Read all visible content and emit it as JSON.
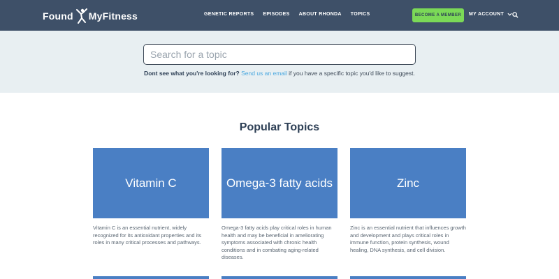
{
  "brand": {
    "name_left": "Found",
    "name_right": "MyFitness"
  },
  "nav": {
    "links": [
      "GENETIC REPORTS",
      "EPISODES",
      "ABOUT RHONDA",
      "TOPICS"
    ],
    "member_button": "BECOME A MEMBER",
    "account_label": "MY ACCOUNT"
  },
  "search": {
    "placeholder": "Search for a topic",
    "hint_strong": "Dont see what you're looking for?",
    "hint_link": "Send us an email",
    "hint_rest": "if you have a specific topic you'd like to suggest."
  },
  "popular": {
    "title": "Popular Topics",
    "cards": [
      {
        "title": "Vitamin C",
        "description": "Vitamin C is an essential nutrient, widely recognized for its antioxidant properties and its roles in many critical processes and pathways."
      },
      {
        "title": "Omega-3 fatty acids",
        "description": "Omega-3 fatty acids play critical roles in human health and may be beneficial in ameliorating symptoms associated with chronic health conditions and in combating aging-related diseases."
      },
      {
        "title": "Zinc",
        "description": "Zinc is an essential nutrient that influences growth and development and plays critical roles in immune function, protein synthesis, wound healing, DNA synthesis, and cell division."
      }
    ]
  },
  "colors": {
    "nav_bg": "#3e5068",
    "accent_green": "#7bd957",
    "card_blue": "#4a7fc4",
    "link_blue": "#4aa8e0",
    "band_bg": "#e8eff2"
  },
  "icons": [
    "runner-logo-icon",
    "chevron-down-icon",
    "search-icon"
  ]
}
